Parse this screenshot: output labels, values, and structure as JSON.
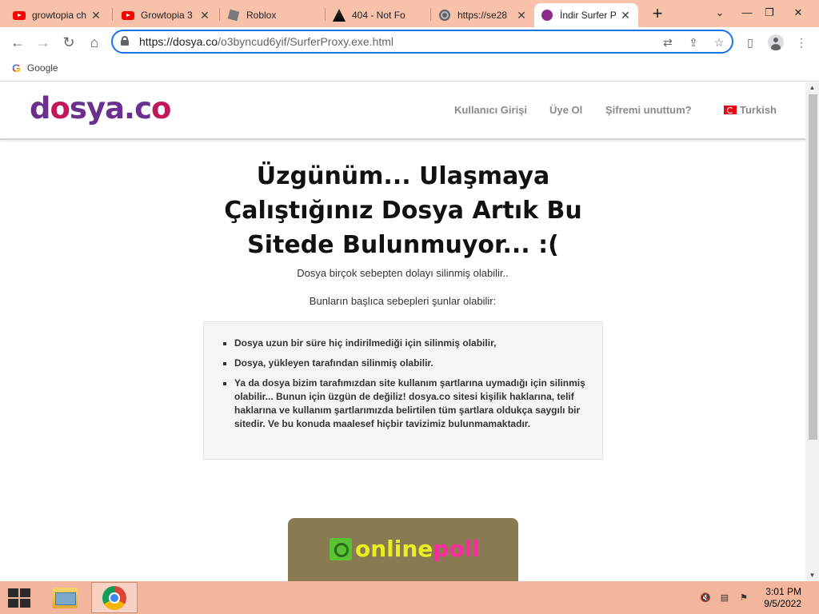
{
  "browser": {
    "tabs": [
      {
        "title": "growtopia ch",
        "icon": "youtube-icon",
        "active": false
      },
      {
        "title": "Growtopia 3",
        "icon": "youtube-icon",
        "active": false
      },
      {
        "title": "Roblox",
        "icon": "roblox-icon",
        "active": false
      },
      {
        "title": "404 - Not Fo",
        "icon": "warning-icon",
        "active": false
      },
      {
        "title": "https://se28",
        "icon": "globe-icon",
        "active": false
      },
      {
        "title": "İndir Surfer P",
        "icon": "surfer-icon",
        "active": true
      }
    ],
    "new_tab": "+",
    "url_host": "https://dosya.co",
    "url_path": "/o3byncud6yif/SurferProxy.exe.html",
    "bookmarks": [
      {
        "label": "Google",
        "icon": "google-icon"
      }
    ]
  },
  "site": {
    "logo": {
      "part1": "d",
      "part2": "o",
      "part3": "sya",
      "part4": ".c",
      "part5": "o"
    },
    "nav": {
      "login": "Kullanıcı Girişi",
      "signup": "Üye Ol",
      "forgot": "Şifremi unuttum?",
      "language": "Turkish"
    },
    "headline": "Üzgünüm... Ulaşmaya Çalıştığınız Dosya Artık Bu Sitede Bulunmuyor... :(",
    "sub1": "Dosya birçok sebepten dolayı silinmiş olabilir..",
    "sub2": "Bunların başlıca sebepleri şunlar olabilir:",
    "reasons": [
      "Dosya uzun bir süre hiç indirilmediği için silinmiş olabilir,",
      "Dosya, yükleyen tarafından silinmiş olabilir.",
      "Ya da dosya bizim tarafımızdan site kullanım şartlarına uymadığı için silinmiş olabilir... Bunun için üzgün de değiliz! dosya.co sitesi kişilik haklarına, telif haklarına ve kullanım şartlarımızda belirtilen tüm şartlara oldukça saygılı bir sitedir. Ve bu konuda maalesef hiçbir tavizimiz bulunmamaktadır."
    ],
    "ad": {
      "word1": "online",
      "word2": "poll"
    }
  },
  "taskbar": {
    "time": "3:01 PM",
    "date": "9/5/2022"
  },
  "colors": {
    "tabstrip": "#f7c2a9",
    "taskbar": "#f2b69c",
    "logo_purple": "#6b2f8e",
    "focus_blue": "#1a73e8"
  }
}
